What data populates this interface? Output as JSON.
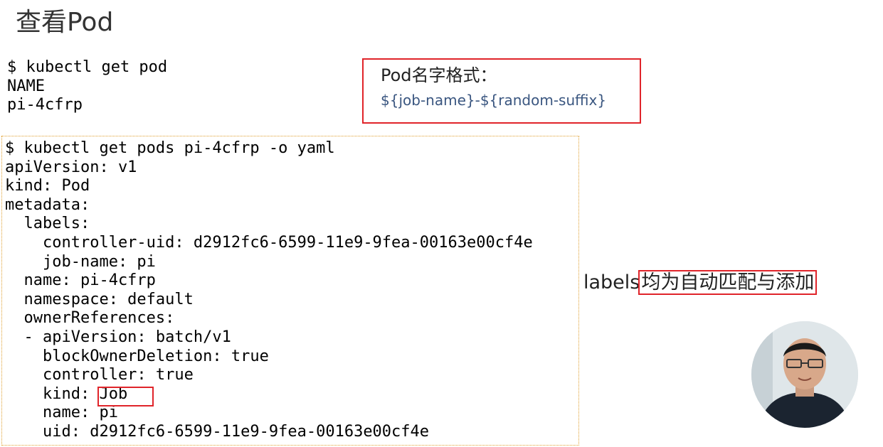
{
  "page": {
    "title": "查看Pod"
  },
  "get_pod": {
    "lines": [
      "$ kubectl get pod",
      "NAME",
      "pi-4cfrp"
    ]
  },
  "callout": {
    "title": "Pod名字格式：",
    "format": "${job-name}-${random-suffix}"
  },
  "yaml": {
    "lines": [
      "$ kubectl get pods pi-4cfrp -o yaml",
      "apiVersion: v1",
      "kind: Pod",
      "metadata:",
      "  labels:",
      "    controller-uid: d2912fc6-6599-11e9-9fea-00163e00cf4e",
      "    job-name: pi",
      "  name: pi-4cfrp",
      "  namespace: default",
      "  ownerReferences:",
      "  - apiVersion: batch/v1",
      "    blockOwnerDeletion: true",
      "    controller: true",
      "    kind: Job",
      "    name: pi",
      "    uid: d2912fc6-6599-11e9-9fea-00163e00cf4e"
    ]
  },
  "labels_note": {
    "prefix": "labels",
    "highlight": "均为自动匹配与添加"
  },
  "colors": {
    "highlight_border": "#e0242a",
    "format_text": "#3a5680",
    "yaml_box_border": "#e0a030"
  },
  "icons": {
    "presenter": "presenter-avatar"
  }
}
